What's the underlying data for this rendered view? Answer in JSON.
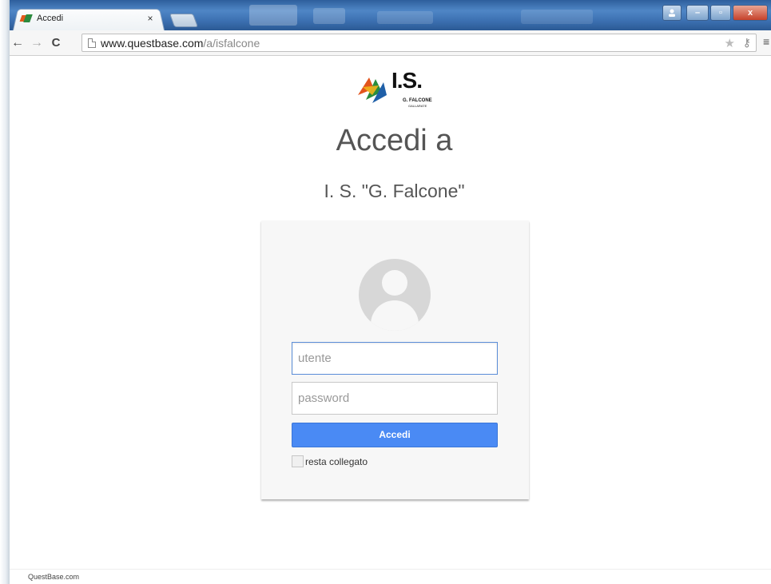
{
  "browser": {
    "tab_title": "Accedi",
    "tab_close": "×",
    "url_host": "www.questbase.com",
    "url_path": "/a/isfalcone",
    "back": "←",
    "forward": "→",
    "reload": "C",
    "star": "★",
    "key": "⚷",
    "menu": "≡",
    "window_controls": {
      "minimize": "–",
      "maximize": "▫",
      "close": "x"
    }
  },
  "logo": {
    "text": "I.S.",
    "line1": "G. FALCONE",
    "line2": "GALLARATE"
  },
  "login": {
    "heading": "Accedi a",
    "subheading": "I. S. \"G. Falcone\"",
    "username_placeholder": "utente",
    "password_placeholder": "password",
    "submit_label": "Accedi",
    "remember_label": "resta collegato"
  },
  "footer": {
    "text": "QuestBase.com"
  },
  "colors": {
    "accent": "#4a8af4",
    "focus_border": "#5b8ed8",
    "card_bg": "#f7f7f7",
    "avatar_bg": "#d7d7d7"
  },
  "icons": [
    "favicon-icon",
    "back-arrow-icon",
    "forward-arrow-icon",
    "reload-icon",
    "page-icon",
    "star-icon",
    "key-icon",
    "menu-icon",
    "avatar-icon"
  ]
}
